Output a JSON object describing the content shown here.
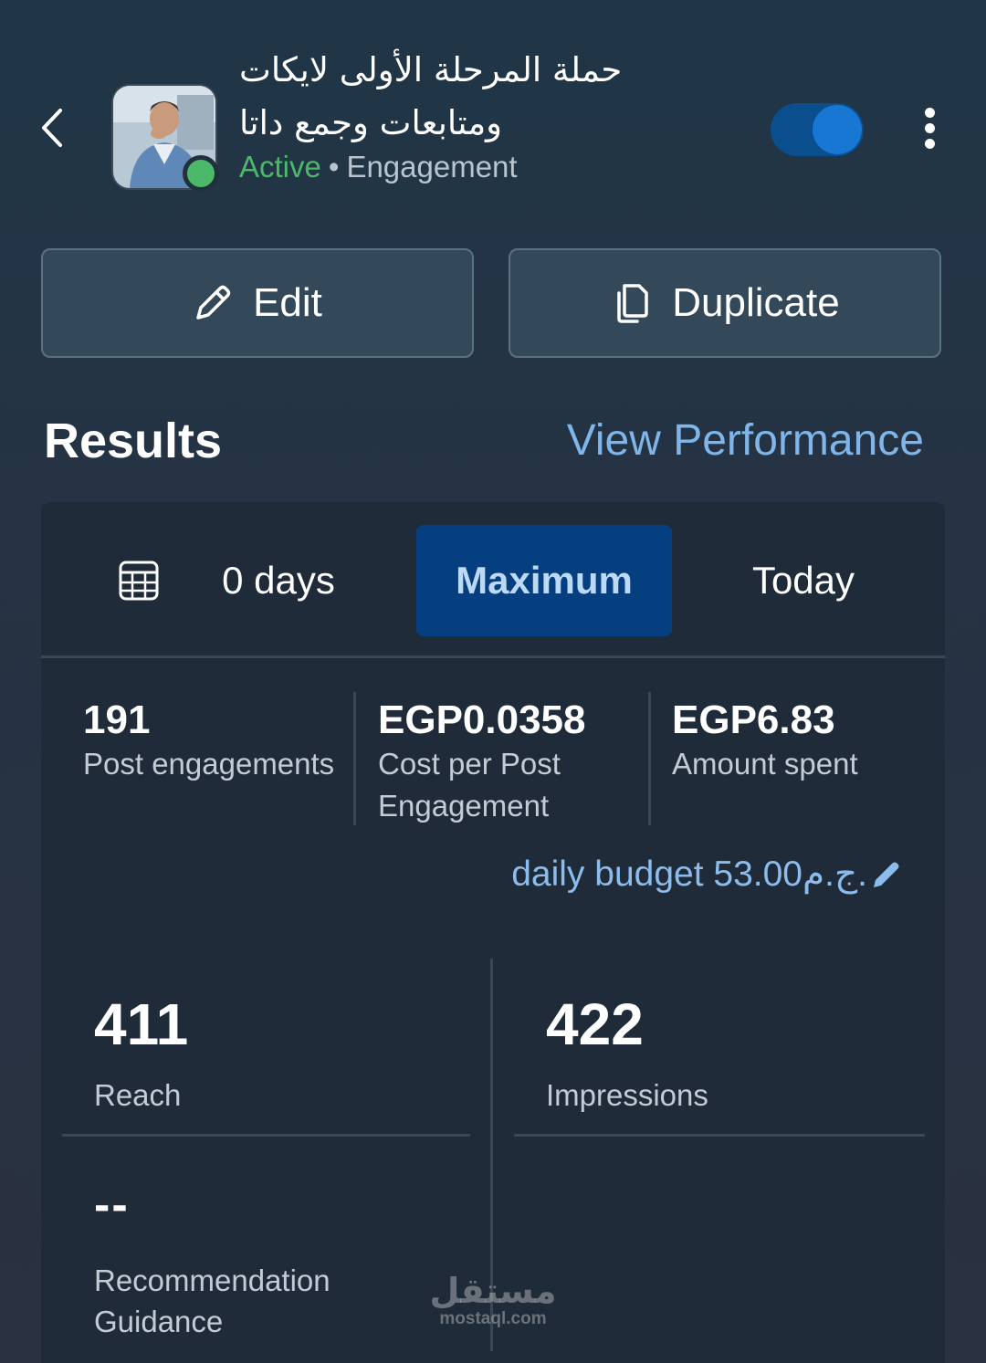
{
  "header": {
    "campaign_title": "حملة المرحلة الأولى لايكات ومتابعات وجمع داتا",
    "status": "Active",
    "separator": "•",
    "objective": "Engagement",
    "toggle_on": true,
    "status_color": "#4bb86a"
  },
  "actions": {
    "edit_label": "Edit",
    "duplicate_label": "Duplicate"
  },
  "results": {
    "title": "Results",
    "view_performance": "View Performance"
  },
  "date_tabs": {
    "days": "0 days",
    "maximum": "Maximum",
    "today": "Today",
    "selected": "Maximum"
  },
  "metrics": [
    {
      "value": "191",
      "label": "Post engagements"
    },
    {
      "value": "EGP0.0358",
      "label": "Cost per Post Engagement"
    },
    {
      "value": "EGP6.83",
      "label": "Amount spent"
    }
  ],
  "budget": {
    "text": "daily budget 53.00ج.م."
  },
  "summary": {
    "reach_value": "411",
    "reach_label": "Reach",
    "impressions_value": "422",
    "impressions_label": "Impressions",
    "recommendation_value": "--",
    "recommendation_label": "Recommendation Guidance"
  },
  "watermark": {
    "arabic": "مستقل",
    "latin": "mostaql.com"
  },
  "colors": {
    "accent": "#1877d2",
    "link": "#7fb5e8",
    "selected_tab": "#063f80"
  }
}
